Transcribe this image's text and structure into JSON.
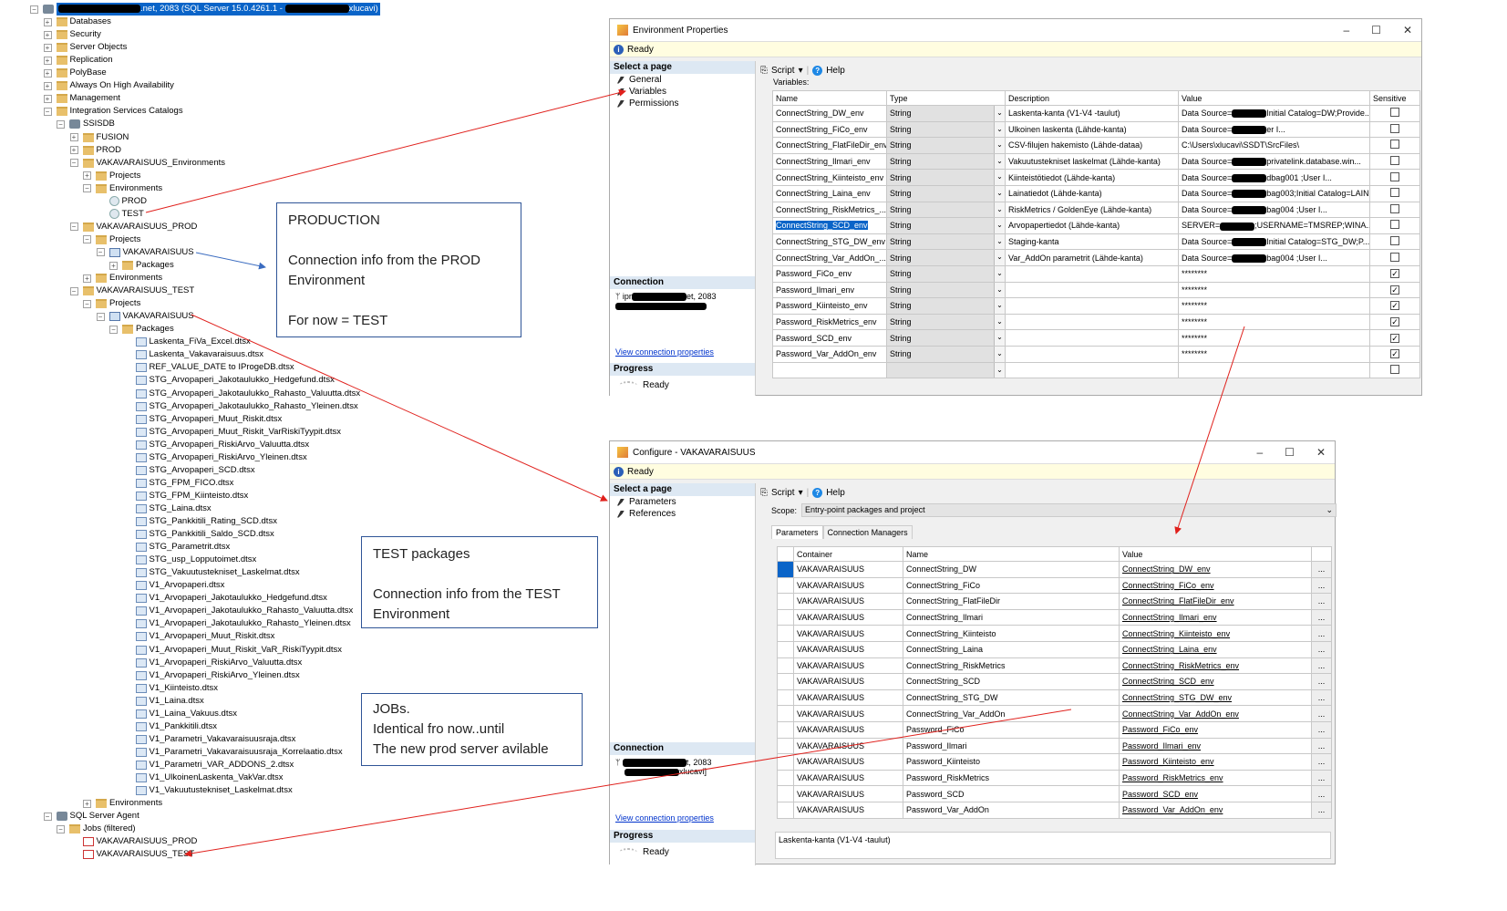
{
  "tree": {
    "root": {
      "label_suffix": ".net, 2083 (SQL Server 15.0.4261.1 - ",
      "label_end": "xlucavi)"
    },
    "items": [
      {
        "level": 1,
        "exp": "+",
        "icon": "folder",
        "label": "Databases"
      },
      {
        "level": 1,
        "exp": "+",
        "icon": "folder",
        "label": "Security"
      },
      {
        "level": 1,
        "exp": "+",
        "icon": "folder",
        "label": "Server Objects"
      },
      {
        "level": 1,
        "exp": "+",
        "icon": "folder",
        "label": "Replication"
      },
      {
        "level": 1,
        "exp": "+",
        "icon": "folder",
        "label": "PolyBase"
      },
      {
        "level": 1,
        "exp": "+",
        "icon": "folder",
        "label": "Always On High Availability"
      },
      {
        "level": 1,
        "exp": "+",
        "icon": "folder",
        "label": "Management"
      },
      {
        "level": 1,
        "exp": "-",
        "icon": "folder",
        "label": "Integration Services Catalogs"
      },
      {
        "level": 2,
        "exp": "-",
        "icon": "db",
        "label": "SSISDB"
      },
      {
        "level": 3,
        "exp": "+",
        "icon": "folder",
        "label": "FUSION"
      },
      {
        "level": 3,
        "exp": "+",
        "icon": "folder",
        "label": "PROD"
      },
      {
        "level": 3,
        "exp": "-",
        "icon": "folder",
        "label": "VAKAVARAISUUS_Environments"
      },
      {
        "level": 4,
        "exp": "+",
        "icon": "folder",
        "label": "Projects"
      },
      {
        "level": 4,
        "exp": "-",
        "icon": "folder",
        "label": "Environments"
      },
      {
        "level": 5,
        "exp": "",
        "icon": "env",
        "label": "PROD"
      },
      {
        "level": 5,
        "exp": "",
        "icon": "env",
        "label": "TEST"
      },
      {
        "level": 3,
        "exp": "-",
        "icon": "folder",
        "label": "VAKAVARAISUUS_PROD"
      },
      {
        "level": 4,
        "exp": "-",
        "icon": "folder",
        "label": "Projects"
      },
      {
        "level": 5,
        "exp": "-",
        "icon": "proj",
        "label": "VAKAVARAISUUS"
      },
      {
        "level": 6,
        "exp": "+",
        "icon": "folder",
        "label": "Packages"
      },
      {
        "level": 4,
        "exp": "+",
        "icon": "folder",
        "label": "Environments"
      },
      {
        "level": 3,
        "exp": "-",
        "icon": "folder",
        "label": "VAKAVARAISUUS_TEST"
      },
      {
        "level": 4,
        "exp": "-",
        "icon": "folder",
        "label": "Projects"
      },
      {
        "level": 5,
        "exp": "-",
        "icon": "proj",
        "label": "VAKAVARAISUUS"
      },
      {
        "level": 6,
        "exp": "-",
        "icon": "folder",
        "label": "Packages"
      },
      {
        "level": 7,
        "exp": "",
        "icon": "pkg",
        "label": "Laskenta_FiVa_Excel.dtsx"
      },
      {
        "level": 7,
        "exp": "",
        "icon": "pkg",
        "label": "Laskenta_Vakavaraisuus.dtsx"
      },
      {
        "level": 7,
        "exp": "",
        "icon": "pkg",
        "label": "REF_VALUE_DATE to IProgeDB.dtsx"
      },
      {
        "level": 7,
        "exp": "",
        "icon": "pkg",
        "label": "STG_Arvopaperi_Jakotaulukko_Hedgefund.dtsx"
      },
      {
        "level": 7,
        "exp": "",
        "icon": "pkg",
        "label": "STG_Arvopaperi_Jakotaulukko_Rahasto_Valuutta.dtsx"
      },
      {
        "level": 7,
        "exp": "",
        "icon": "pkg",
        "label": "STG_Arvopaperi_Jakotaulukko_Rahasto_Yleinen.dtsx"
      },
      {
        "level": 7,
        "exp": "",
        "icon": "pkg",
        "label": "STG_Arvopaperi_Muut_Riskit.dtsx"
      },
      {
        "level": 7,
        "exp": "",
        "icon": "pkg",
        "label": "STG_Arvopaperi_Muut_Riskit_VarRiskiTyypit.dtsx"
      },
      {
        "level": 7,
        "exp": "",
        "icon": "pkg",
        "label": "STG_Arvopaperi_RiskiArvo_Valuutta.dtsx"
      },
      {
        "level": 7,
        "exp": "",
        "icon": "pkg",
        "label": "STG_Arvopaperi_RiskiArvo_Yleinen.dtsx"
      },
      {
        "level": 7,
        "exp": "",
        "icon": "pkg",
        "label": "STG_Arvopaperi_SCD.dtsx"
      },
      {
        "level": 7,
        "exp": "",
        "icon": "pkg",
        "label": "STG_FPM_FICO.dtsx"
      },
      {
        "level": 7,
        "exp": "",
        "icon": "pkg",
        "label": "STG_FPM_Kiinteisto.dtsx"
      },
      {
        "level": 7,
        "exp": "",
        "icon": "pkg",
        "label": "STG_Laina.dtsx"
      },
      {
        "level": 7,
        "exp": "",
        "icon": "pkg",
        "label": "STG_Pankkitili_Rating_SCD.dtsx"
      },
      {
        "level": 7,
        "exp": "",
        "icon": "pkg",
        "label": "STG_Pankkitili_Saldo_SCD.dtsx"
      },
      {
        "level": 7,
        "exp": "",
        "icon": "pkg",
        "label": "STG_Parametrit.dtsx"
      },
      {
        "level": 7,
        "exp": "",
        "icon": "pkg",
        "label": "STG_usp_Lopputoimet.dtsx"
      },
      {
        "level": 7,
        "exp": "",
        "icon": "pkg",
        "label": "STG_Vakuutustekniset_Laskelmat.dtsx"
      },
      {
        "level": 7,
        "exp": "",
        "icon": "pkg",
        "label": "V1_Arvopaperi.dtsx"
      },
      {
        "level": 7,
        "exp": "",
        "icon": "pkg",
        "label": "V1_Arvopaperi_Jakotaulukko_Hedgefund.dtsx"
      },
      {
        "level": 7,
        "exp": "",
        "icon": "pkg",
        "label": "V1_Arvopaperi_Jakotaulukko_Rahasto_Valuutta.dtsx"
      },
      {
        "level": 7,
        "exp": "",
        "icon": "pkg",
        "label": "V1_Arvopaperi_Jakotaulukko_Rahasto_Yleinen.dtsx"
      },
      {
        "level": 7,
        "exp": "",
        "icon": "pkg",
        "label": "V1_Arvopaperi_Muut_Riskit.dtsx"
      },
      {
        "level": 7,
        "exp": "",
        "icon": "pkg",
        "label": "V1_Arvopaperi_Muut_Riskit_VaR_RiskiTyypit.dtsx"
      },
      {
        "level": 7,
        "exp": "",
        "icon": "pkg",
        "label": "V1_Arvopaperi_RiskiArvo_Valuutta.dtsx"
      },
      {
        "level": 7,
        "exp": "",
        "icon": "pkg",
        "label": "V1_Arvopaperi_RiskiArvo_Yleinen.dtsx"
      },
      {
        "level": 7,
        "exp": "",
        "icon": "pkg",
        "label": "V1_Kiinteisto.dtsx"
      },
      {
        "level": 7,
        "exp": "",
        "icon": "pkg",
        "label": "V1_Laina.dtsx"
      },
      {
        "level": 7,
        "exp": "",
        "icon": "pkg",
        "label": "V1_Laina_Vakuus.dtsx"
      },
      {
        "level": 7,
        "exp": "",
        "icon": "pkg",
        "label": "V1_Pankkitili.dtsx"
      },
      {
        "level": 7,
        "exp": "",
        "icon": "pkg",
        "label": "V1_Parametri_Vakavaraisuusraja.dtsx"
      },
      {
        "level": 7,
        "exp": "",
        "icon": "pkg",
        "label": "V1_Parametri_Vakavaraisuusraja_Korrelaatio.dtsx"
      },
      {
        "level": 7,
        "exp": "",
        "icon": "pkg",
        "label": "V1_Parametri_VAR_ADDONS_2.dtsx"
      },
      {
        "level": 7,
        "exp": "",
        "icon": "pkg",
        "label": "V1_UlkoinenLaskenta_VakVar.dtsx"
      },
      {
        "level": 7,
        "exp": "",
        "icon": "pkg",
        "label": "V1_Vakuutustekniset_Laskelmat.dtsx"
      },
      {
        "level": 4,
        "exp": "+",
        "icon": "folder",
        "label": "Environments"
      },
      {
        "level": 1,
        "exp": "-",
        "icon": "db",
        "label": "SQL Server Agent"
      },
      {
        "level": 2,
        "exp": "-",
        "icon": "folder",
        "label": "Jobs (filtered)"
      },
      {
        "level": 3,
        "exp": "",
        "icon": "job",
        "label": "VAKAVARAISUUS_PROD"
      },
      {
        "level": 3,
        "exp": "",
        "icon": "job",
        "label": "VAKAVARAISUUS_TEST"
      }
    ]
  },
  "callouts": {
    "production": [
      "PRODUCTION",
      "",
      "Connection info from the PROD Environment",
      "",
      "For now = TEST"
    ],
    "test": [
      "TEST packages",
      "",
      "Connection info from the TEST Environment"
    ],
    "jobs": [
      "JOBs.",
      "Identical fro now..until",
      "The new prod server avilable"
    ]
  },
  "env_dialog": {
    "title": "Environment Properties",
    "status": "Ready",
    "select_page": "Select a page",
    "pages": [
      "General",
      "Variables",
      "Permissions"
    ],
    "script": "Script",
    "help": "Help",
    "variables_label": "Variables:",
    "columns": [
      "Name",
      "Type",
      "Description",
      "Value",
      "Sensitive"
    ],
    "connection_header": "Connection",
    "connection_server_prefix": "ipr",
    "connection_server_suffix": "et, 2083",
    "view_connection": "View connection properties",
    "progress_header": "Progress",
    "progress_status": "Ready",
    "rows": [
      {
        "name": "ConnectString_DW_env",
        "type": "String",
        "desc": "Laskenta-kanta (V1-V4 -taulut)",
        "pre": "Data Source=",
        "post": "Initial Catalog=DW;Provide...",
        "sensitive": false
      },
      {
        "name": "ConnectString_FiCo_env",
        "type": "String",
        "desc": "Ulkoinen laskenta (Lähde-kanta)",
        "pre": "Data Source=",
        "post": "er I...",
        "sensitive": false
      },
      {
        "name": "ConnectString_FlatFileDir_env",
        "type": "String",
        "desc": "CSV-filujen hakemisto (Lähde-dataa)",
        "pre": "C:\\Users\\xlucavi\\SSDT\\SrcFiles\\",
        "post": "",
        "sensitive": false
      },
      {
        "name": "ConnectString_Ilmari_env",
        "type": "String",
        "desc": "Vakuutustekniset laskelmat (Lähde-kanta)",
        "pre": "Data Source=",
        "post": "privatelink.database.win...",
        "sensitive": false
      },
      {
        "name": "ConnectString_Kiinteisto_env",
        "type": "String",
        "desc": "Kiinteistötiedot (Lähde-kanta)",
        "pre": "Data Source=",
        "post": "dbag001 ;User I...",
        "sensitive": false
      },
      {
        "name": "ConnectString_Laina_env",
        "type": "String",
        "desc": "Lainatiedot (Lähde-kanta)",
        "pre": "Data Source=",
        "post": "bag003;Initial Catalog=LAIN...",
        "sensitive": false
      },
      {
        "name": "ConnectString_RiskMetrics_...",
        "type": "String",
        "desc": "RiskMetrics / GoldenEye (Lähde-kanta)",
        "pre": "Data Source=",
        "post": "bag004 ;User I...",
        "sensitive": false
      },
      {
        "name": "ConnectString_SCD_env",
        "type": "String",
        "desc": "Arvopapertiedot (Lähde-kanta)",
        "pre": "SERVER=",
        "post": ";USERNAME=TMSREP;WINA...",
        "sensitive": false,
        "selected": true
      },
      {
        "name": "ConnectString_STG_DW_env",
        "type": "String",
        "desc": "Staging-kanta",
        "pre": "Data Source=",
        "post": "Initial Catalog=STG_DW;P...",
        "sensitive": false
      },
      {
        "name": "ConnectString_Var_AddOn_...",
        "type": "String",
        "desc": "Var_AddOn parametrit (Lähde-kanta)",
        "pre": "Data Source=",
        "post": "bag004 ;User I...",
        "sensitive": false
      },
      {
        "name": "Password_FiCo_env",
        "type": "String",
        "desc": "",
        "pre": "********",
        "post": "",
        "sensitive": true
      },
      {
        "name": "Password_Ilmari_env",
        "type": "String",
        "desc": "",
        "pre": "********",
        "post": "",
        "sensitive": true
      },
      {
        "name": "Password_Kiinteisto_env",
        "type": "String",
        "desc": "",
        "pre": "********",
        "post": "",
        "sensitive": true
      },
      {
        "name": "Password_RiskMetrics_env",
        "type": "String",
        "desc": "",
        "pre": "********",
        "post": "",
        "sensitive": true
      },
      {
        "name": "Password_SCD_env",
        "type": "String",
        "desc": "",
        "pre": "********",
        "post": "",
        "sensitive": true
      },
      {
        "name": "Password_Var_AddOn_env",
        "type": "String",
        "desc": "",
        "pre": "********",
        "post": "",
        "sensitive": true
      }
    ]
  },
  "cfg_dialog": {
    "title": "Configure - VAKAVARAISUUS",
    "status": "Ready",
    "select_page": "Select a page",
    "pages": [
      "Parameters",
      "References"
    ],
    "script": "Script",
    "help": "Help",
    "scope_label": "Scope:",
    "scope_value": "Entry-point packages and project",
    "tabs": [
      "Parameters",
      "Connection Managers"
    ],
    "columns": [
      "Container",
      "Name",
      "Value"
    ],
    "connection_header": "Connection",
    "connection_server_suffix": "t, 2083",
    "connection_user_suffix": "xlucavi]",
    "view_connection": "View connection properties",
    "progress_header": "Progress",
    "progress_status": "Ready",
    "description": "Laskenta-kanta (V1-V4 -taulut)",
    "rows": [
      {
        "container": "VAKAVARAISUUS",
        "name": "ConnectString_DW",
        "value": "ConnectString_DW_env"
      },
      {
        "container": "VAKAVARAISUUS",
        "name": "ConnectString_FiCo",
        "value": "ConnectString_FiCo_env"
      },
      {
        "container": "VAKAVARAISUUS",
        "name": "ConnectString_FlatFileDir",
        "value": "ConnectString_FlatFileDir_env"
      },
      {
        "container": "VAKAVARAISUUS",
        "name": "ConnectString_Ilmari",
        "value": "ConnectString_Ilmari_env"
      },
      {
        "container": "VAKAVARAISUUS",
        "name": "ConnectString_Kiinteisto",
        "value": "ConnectString_Kiinteisto_env"
      },
      {
        "container": "VAKAVARAISUUS",
        "name": "ConnectString_Laina",
        "value": "ConnectString_Laina_env"
      },
      {
        "container": "VAKAVARAISUUS",
        "name": "ConnectString_RiskMetrics",
        "value": "ConnectString_RiskMetrics_env"
      },
      {
        "container": "VAKAVARAISUUS",
        "name": "ConnectString_SCD",
        "value": "ConnectString_SCD_env"
      },
      {
        "container": "VAKAVARAISUUS",
        "name": "ConnectString_STG_DW",
        "value": "ConnectString_STG_DW_env"
      },
      {
        "container": "VAKAVARAISUUS",
        "name": "ConnectString_Var_AddOn",
        "value": "ConnectString_Var_AddOn_env"
      },
      {
        "container": "VAKAVARAISUUS",
        "name": "Password_FiCo",
        "value": "Password_FiCo_env"
      },
      {
        "container": "VAKAVARAISUUS",
        "name": "Password_Ilmari",
        "value": "Password_Ilmari_env"
      },
      {
        "container": "VAKAVARAISUUS",
        "name": "Password_Kiinteisto",
        "value": "Password_Kiinteisto_env"
      },
      {
        "container": "VAKAVARAISUUS",
        "name": "Password_RiskMetrics",
        "value": "Password_RiskMetrics_env"
      },
      {
        "container": "VAKAVARAISUUS",
        "name": "Password_SCD",
        "value": "Password_SCD_env"
      },
      {
        "container": "VAKAVARAISUUS",
        "name": "Password_Var_AddOn",
        "value": "Password_Var_AddOn_env"
      }
    ]
  },
  "colors": {
    "arrow_red": "#e0201c",
    "arrow_blue": "#3b6cc0",
    "selection": "#0a64c8"
  }
}
